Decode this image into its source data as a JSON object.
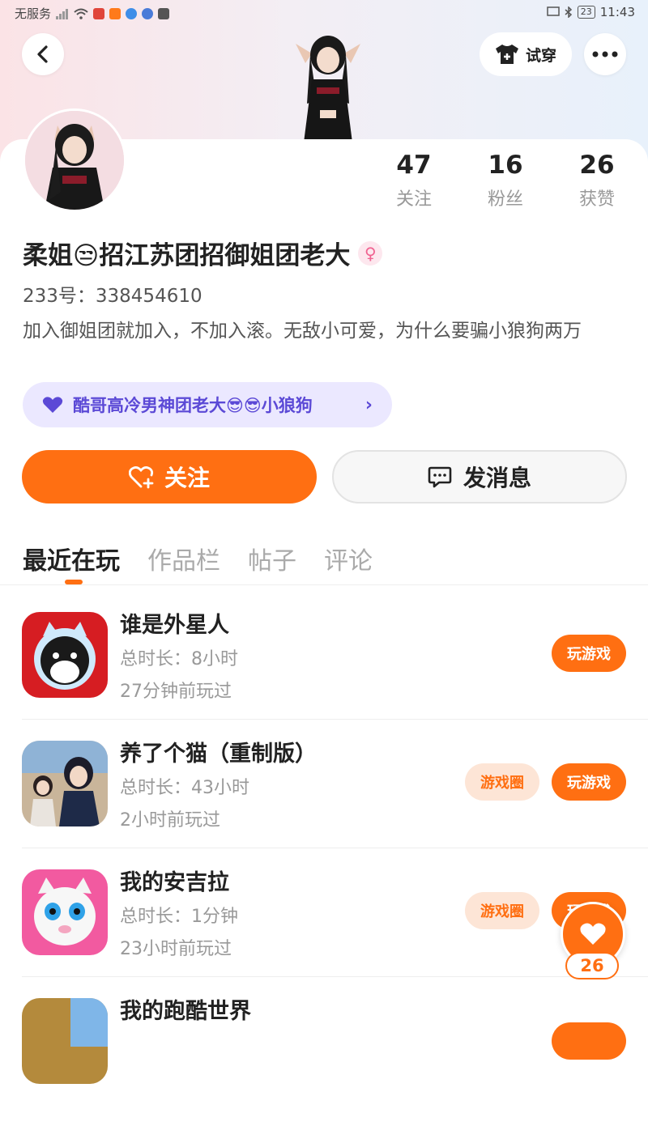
{
  "status_bar": {
    "carrier": "无服务",
    "battery": "23",
    "time": "11:43"
  },
  "header": {
    "try_on_label": "试穿"
  },
  "profile": {
    "stats": [
      {
        "value": "47",
        "label": "关注"
      },
      {
        "value": "16",
        "label": "粉丝"
      },
      {
        "value": "26",
        "label": "获赞"
      }
    ],
    "name": "柔姐😒招江苏团招御姐团老大",
    "gender_symbol": "♀",
    "uid": "233号：338454610",
    "bio": "加入御姐团就加入，不加入滚。无敌小可爱，为什么要骗小狼狗两万",
    "group_label": "酷哥高冷男神团老大😎😎小狼狗"
  },
  "actions": {
    "follow_label": "关注",
    "message_label": "发消息"
  },
  "tabs": [
    "最近在玩",
    "作品栏",
    "帖子",
    "评论"
  ],
  "games": [
    {
      "title": "谁是外星人",
      "duration": "总时长：8小时",
      "last_played": "27分钟前玩过",
      "play_label": "玩游戏",
      "circle_label": ""
    },
    {
      "title": "养了个猫（重制版）",
      "duration": "总时长：43小时",
      "last_played": "2小时前玩过",
      "play_label": "玩游戏",
      "circle_label": "游戏圈"
    },
    {
      "title": "我的安吉拉",
      "duration": "总时长：1分钟",
      "last_played": "23小时前玩过",
      "play_label": "玩游戏",
      "circle_label": "游戏圈"
    },
    {
      "title": "我的跑酷世界",
      "duration": "",
      "last_played": "",
      "play_label": "",
      "circle_label": ""
    }
  ],
  "floating": {
    "like_count": "26"
  },
  "colors": {
    "accent": "#ff6f12",
    "group_text": "#5b49d6",
    "group_bg": "#ebe8ff"
  }
}
